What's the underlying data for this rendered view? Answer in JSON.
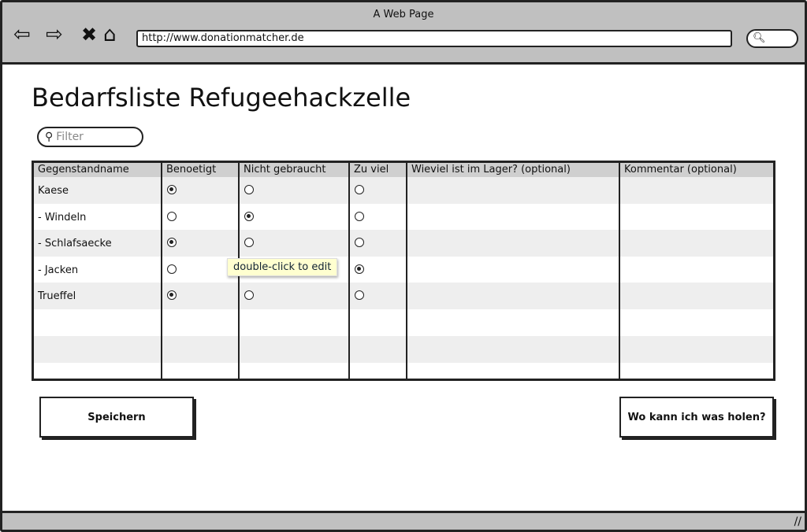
{
  "browser": {
    "title": "A Web Page",
    "url": "http://www.donationmatcher.de"
  },
  "page": {
    "title": "Bedarfsliste Refugeehackzelle",
    "filter_placeholder": "Filter"
  },
  "table": {
    "columns": [
      "Gegenstandname",
      "Benoetigt",
      "Nicht gebraucht",
      "Zu viel",
      "Wieviel ist im Lager? (optional)",
      "Kommentar (optional)"
    ],
    "rows": [
      {
        "name": "Kaese",
        "selected": "Benoetigt"
      },
      {
        "name": "- Windeln",
        "selected": "Nicht gebraucht"
      },
      {
        "name": "- Schlafsaecke",
        "selected": "Benoetigt"
      },
      {
        "name": "- Jacken",
        "selected": "Zu viel"
      },
      {
        "name": "Trueffel",
        "selected": "Benoetigt"
      }
    ]
  },
  "tooltip": "double-click to edit",
  "buttons": {
    "save": "Speichern",
    "where": "Wo kann ich was holen?"
  }
}
